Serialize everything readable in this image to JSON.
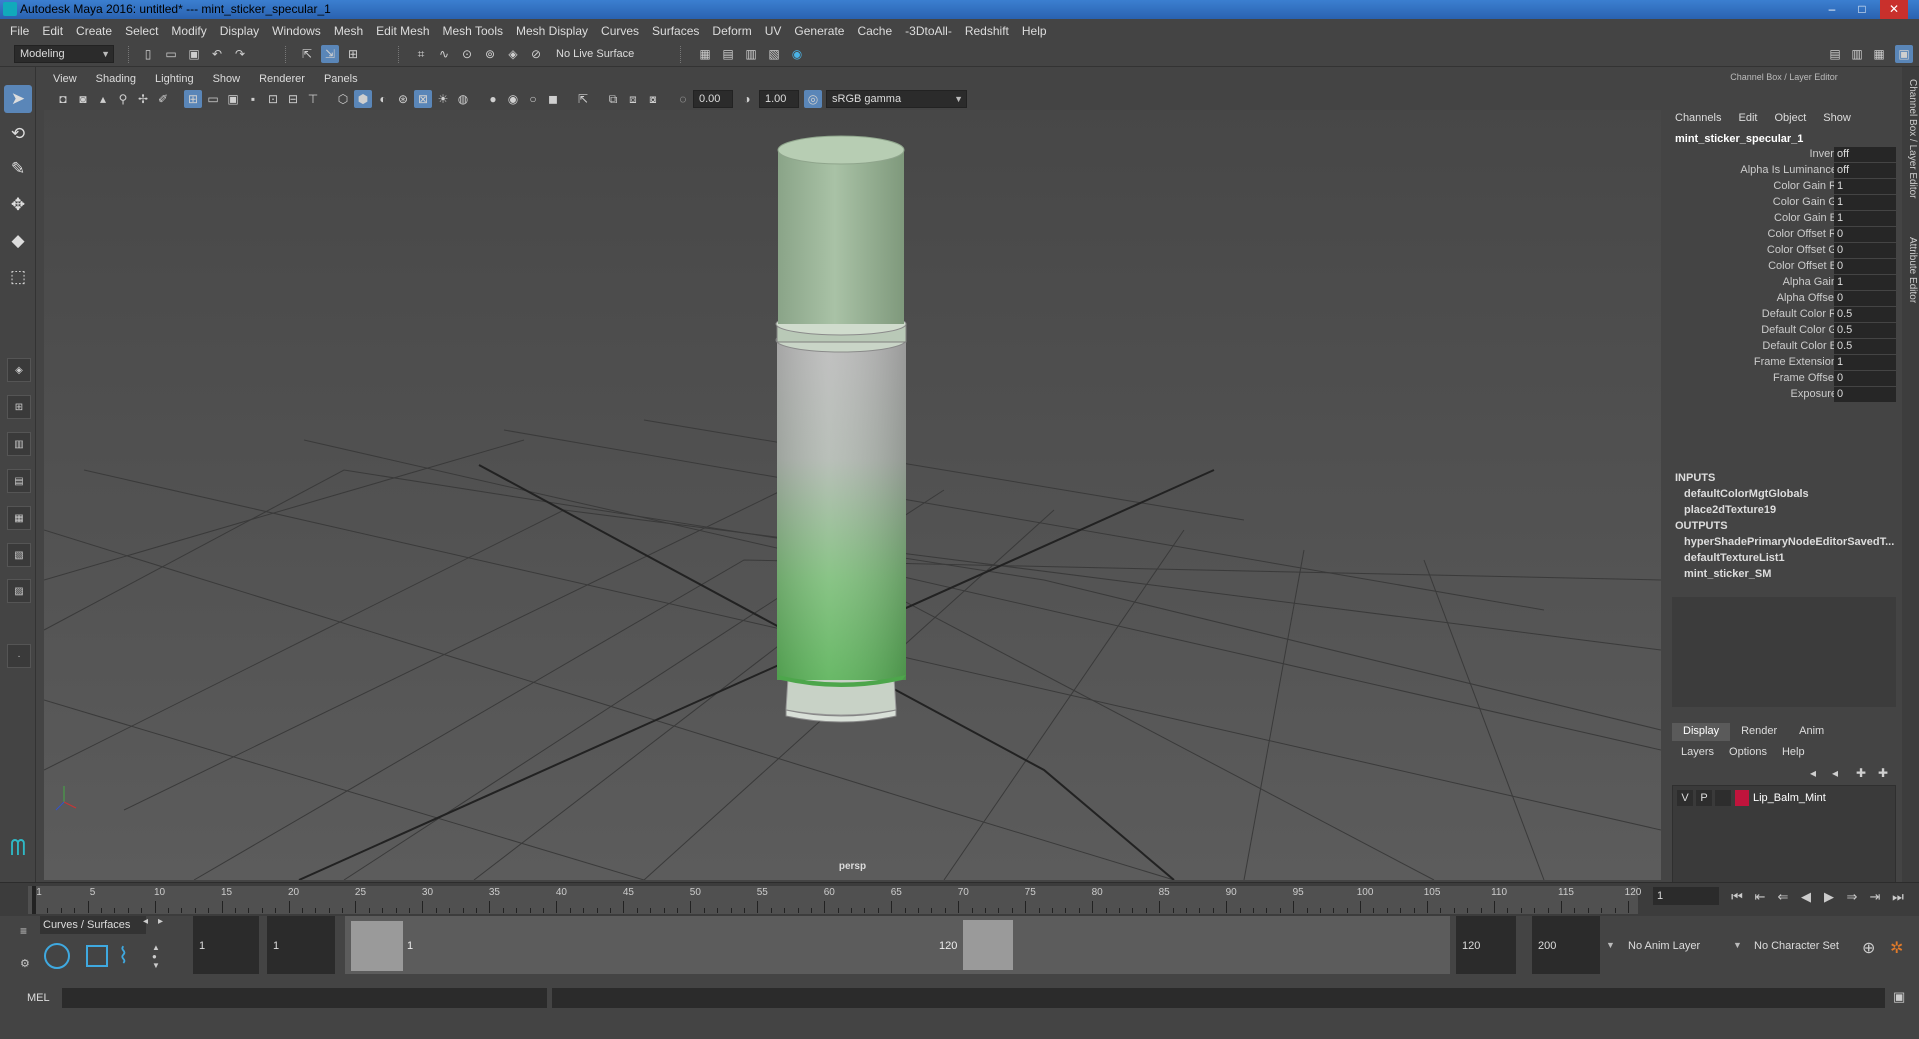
{
  "window": {
    "title": "Autodesk Maya 2016: untitled*   ---   mint_sticker_specular_1",
    "min": "–",
    "max": "□",
    "close": "✕"
  },
  "menu": [
    "File",
    "Edit",
    "Create",
    "Select",
    "Modify",
    "Display",
    "Windows",
    "Mesh",
    "Edit Mesh",
    "Mesh Tools",
    "Mesh Display",
    "Curves",
    "Surfaces",
    "Deform",
    "UV",
    "Generate",
    "Cache",
    "-3DtoAll-",
    "Redshift",
    "Help"
  ],
  "status": {
    "mode": "Modeling",
    "live_surface": "No Live Surface"
  },
  "viewport": {
    "menu": [
      "View",
      "Shading",
      "Lighting",
      "Show",
      "Renderer",
      "Panels"
    ],
    "exposure": "0.00",
    "gamma": "1.00",
    "color_space": "sRGB gamma",
    "camera": "persp"
  },
  "channel_box": {
    "title": "Channel Box / Layer Editor",
    "menu": [
      "Channels",
      "Edit",
      "Object",
      "Show"
    ],
    "node": "mint_sticker_specular_1",
    "attributes": [
      {
        "name": "Invert",
        "value": "off"
      },
      {
        "name": "Alpha Is Luminance",
        "value": "off"
      },
      {
        "name": "Color Gain R",
        "value": "1"
      },
      {
        "name": "Color Gain G",
        "value": "1"
      },
      {
        "name": "Color Gain B",
        "value": "1"
      },
      {
        "name": "Color Offset R",
        "value": "0"
      },
      {
        "name": "Color Offset G",
        "value": "0"
      },
      {
        "name": "Color Offset B",
        "value": "0"
      },
      {
        "name": "Alpha Gain",
        "value": "1"
      },
      {
        "name": "Alpha Offset",
        "value": "0"
      },
      {
        "name": "Default Color R",
        "value": "0.5"
      },
      {
        "name": "Default Color G",
        "value": "0.5"
      },
      {
        "name": "Default Color B",
        "value": "0.5"
      },
      {
        "name": "Frame Extension",
        "value": "1"
      },
      {
        "name": "Frame Offset",
        "value": "0"
      },
      {
        "name": "Exposure",
        "value": "0"
      }
    ],
    "inputs_label": "INPUTS",
    "inputs": [
      "defaultColorMgtGlobals",
      "place2dTexture19"
    ],
    "outputs_label": "OUTPUTS",
    "outputs": [
      "hyperShadePrimaryNodeEditorSavedT...",
      "defaultTextureList1",
      "mint_sticker_SM"
    ]
  },
  "layer_editor": {
    "tabs": [
      "Display",
      "Render",
      "Anim"
    ],
    "menu": [
      "Layers",
      "Options",
      "Help"
    ],
    "layer": {
      "v": "V",
      "p": "P",
      "name": "Lip_Balm_Mint",
      "color": "#c0143c"
    }
  },
  "side_tabs": [
    "Channel Box / Layer Editor",
    "Attribute Editor"
  ],
  "timeline": {
    "ticks": [
      "1",
      "5",
      "10",
      "15",
      "20",
      "25",
      "30",
      "35",
      "40",
      "45",
      "50",
      "55",
      "60",
      "65",
      "70",
      "75",
      "80",
      "85",
      "90",
      "95",
      "100",
      "105",
      "110",
      "115",
      "120"
    ],
    "current_frame": "1"
  },
  "range": {
    "shelf": "Curves / Surfaces",
    "start": "1",
    "anim_start": "1",
    "range_start_label": "1",
    "range_end_label": "120",
    "end": "120",
    "anim_end": "200",
    "anim_layer": "No Anim Layer",
    "character_set": "No Character Set"
  },
  "command": {
    "lang": "MEL"
  }
}
